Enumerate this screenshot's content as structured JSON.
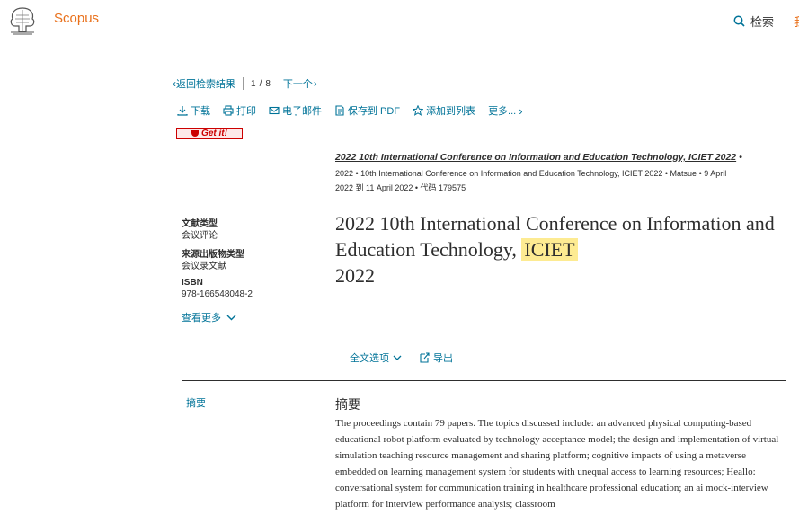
{
  "header": {
    "brand": "Scopus",
    "search_label": "检索",
    "cut_label": "我"
  },
  "nav": {
    "back_label": "返回检索结果",
    "page_current": "1",
    "page_sep": "/",
    "page_total": "8",
    "next_label": "下一个"
  },
  "toolbar": {
    "download": "下载",
    "print": "打印",
    "email": "电子邮件",
    "save_pdf": "保存到 PDF",
    "add_list": "添加到列表",
    "more": "更多..."
  },
  "getit": "Get it!",
  "document": {
    "series": "2022 10th International Conference on Information and Education Technology, ICIET 2022",
    "meta_line1": "2022 • 10th International Conference on Information and Education Technology, ICIET 2022 • Matsue • 9 April",
    "meta_line2": "2022 到 11 April 2022 • 代码 179575",
    "title_main": "2022 10th International Conference on Information and Education Technology,",
    "title_hl": "ICIET",
    "title_end": "2022"
  },
  "info": {
    "doc_type_label": "文献类型",
    "doc_type_value": "会议评论",
    "source_type_label": "来源出版物类型",
    "source_type_value": "会议录文献",
    "isbn_label": "ISBN",
    "isbn_value": "978-166548048-2",
    "more_label": "查看更多"
  },
  "options": {
    "fulltext": "全文选项",
    "export": "导出"
  },
  "abstract": {
    "nav_label": "摘要",
    "heading": "摘要",
    "text": "The proceedings contain 79 papers. The topics discussed include: an advanced physical computing-based educational robot platform evaluated by technology acceptance model; the design and implementation of virtual simulation teaching resource management and sharing platform; cognitive impacts of using a metaverse embedded on learning management system for students with unequal access to learning resources; Heallo: conversational system for communication training in healthcare professional education; an ai mock-interview platform for interview performance analysis; classroom"
  },
  "colors": {
    "accent": "#007398",
    "brand": "#e9711c",
    "highlight": "#fdeb92",
    "text": "#2e2e2e"
  }
}
